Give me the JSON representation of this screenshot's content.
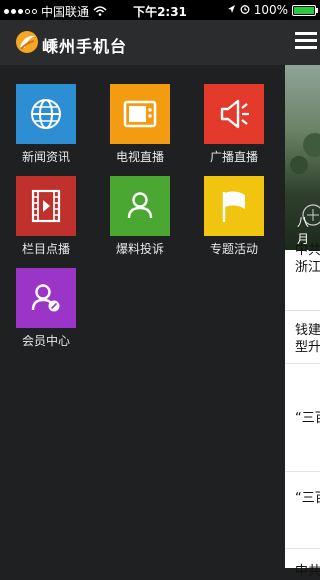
{
  "status": {
    "carrier": "中国联通",
    "time": "下午2:31",
    "battery": "100%"
  },
  "app": {
    "title": "嵊州手机台"
  },
  "menu": [
    {
      "label": "新闻资讯",
      "color": "#2d8ed4",
      "icon": "globe-icon"
    },
    {
      "label": "电视直播",
      "color": "#f39c12",
      "icon": "tv-icon"
    },
    {
      "label": "广播直播",
      "color": "#e33a2b",
      "icon": "speaker-icon"
    },
    {
      "label": "栏目点播",
      "color": "#c0302c",
      "icon": "film-icon"
    },
    {
      "label": "爆料投诉",
      "color": "#4aa832",
      "icon": "person-icon"
    },
    {
      "label": "专题活动",
      "color": "#f1c40f",
      "icon": "flag-icon"
    },
    {
      "label": "会员中心",
      "color": "#9b35c8",
      "icon": "member-icon"
    }
  ],
  "news": {
    "caption": "八月",
    "items": [
      {
        "line1": "中共",
        "line2": "浙江"
      },
      {
        "line1": "钱建",
        "line2": "型升"
      },
      {
        "line1": "“三百"
      },
      {
        "line1": "“三百"
      },
      {
        "line1": "中共"
      }
    ]
  }
}
